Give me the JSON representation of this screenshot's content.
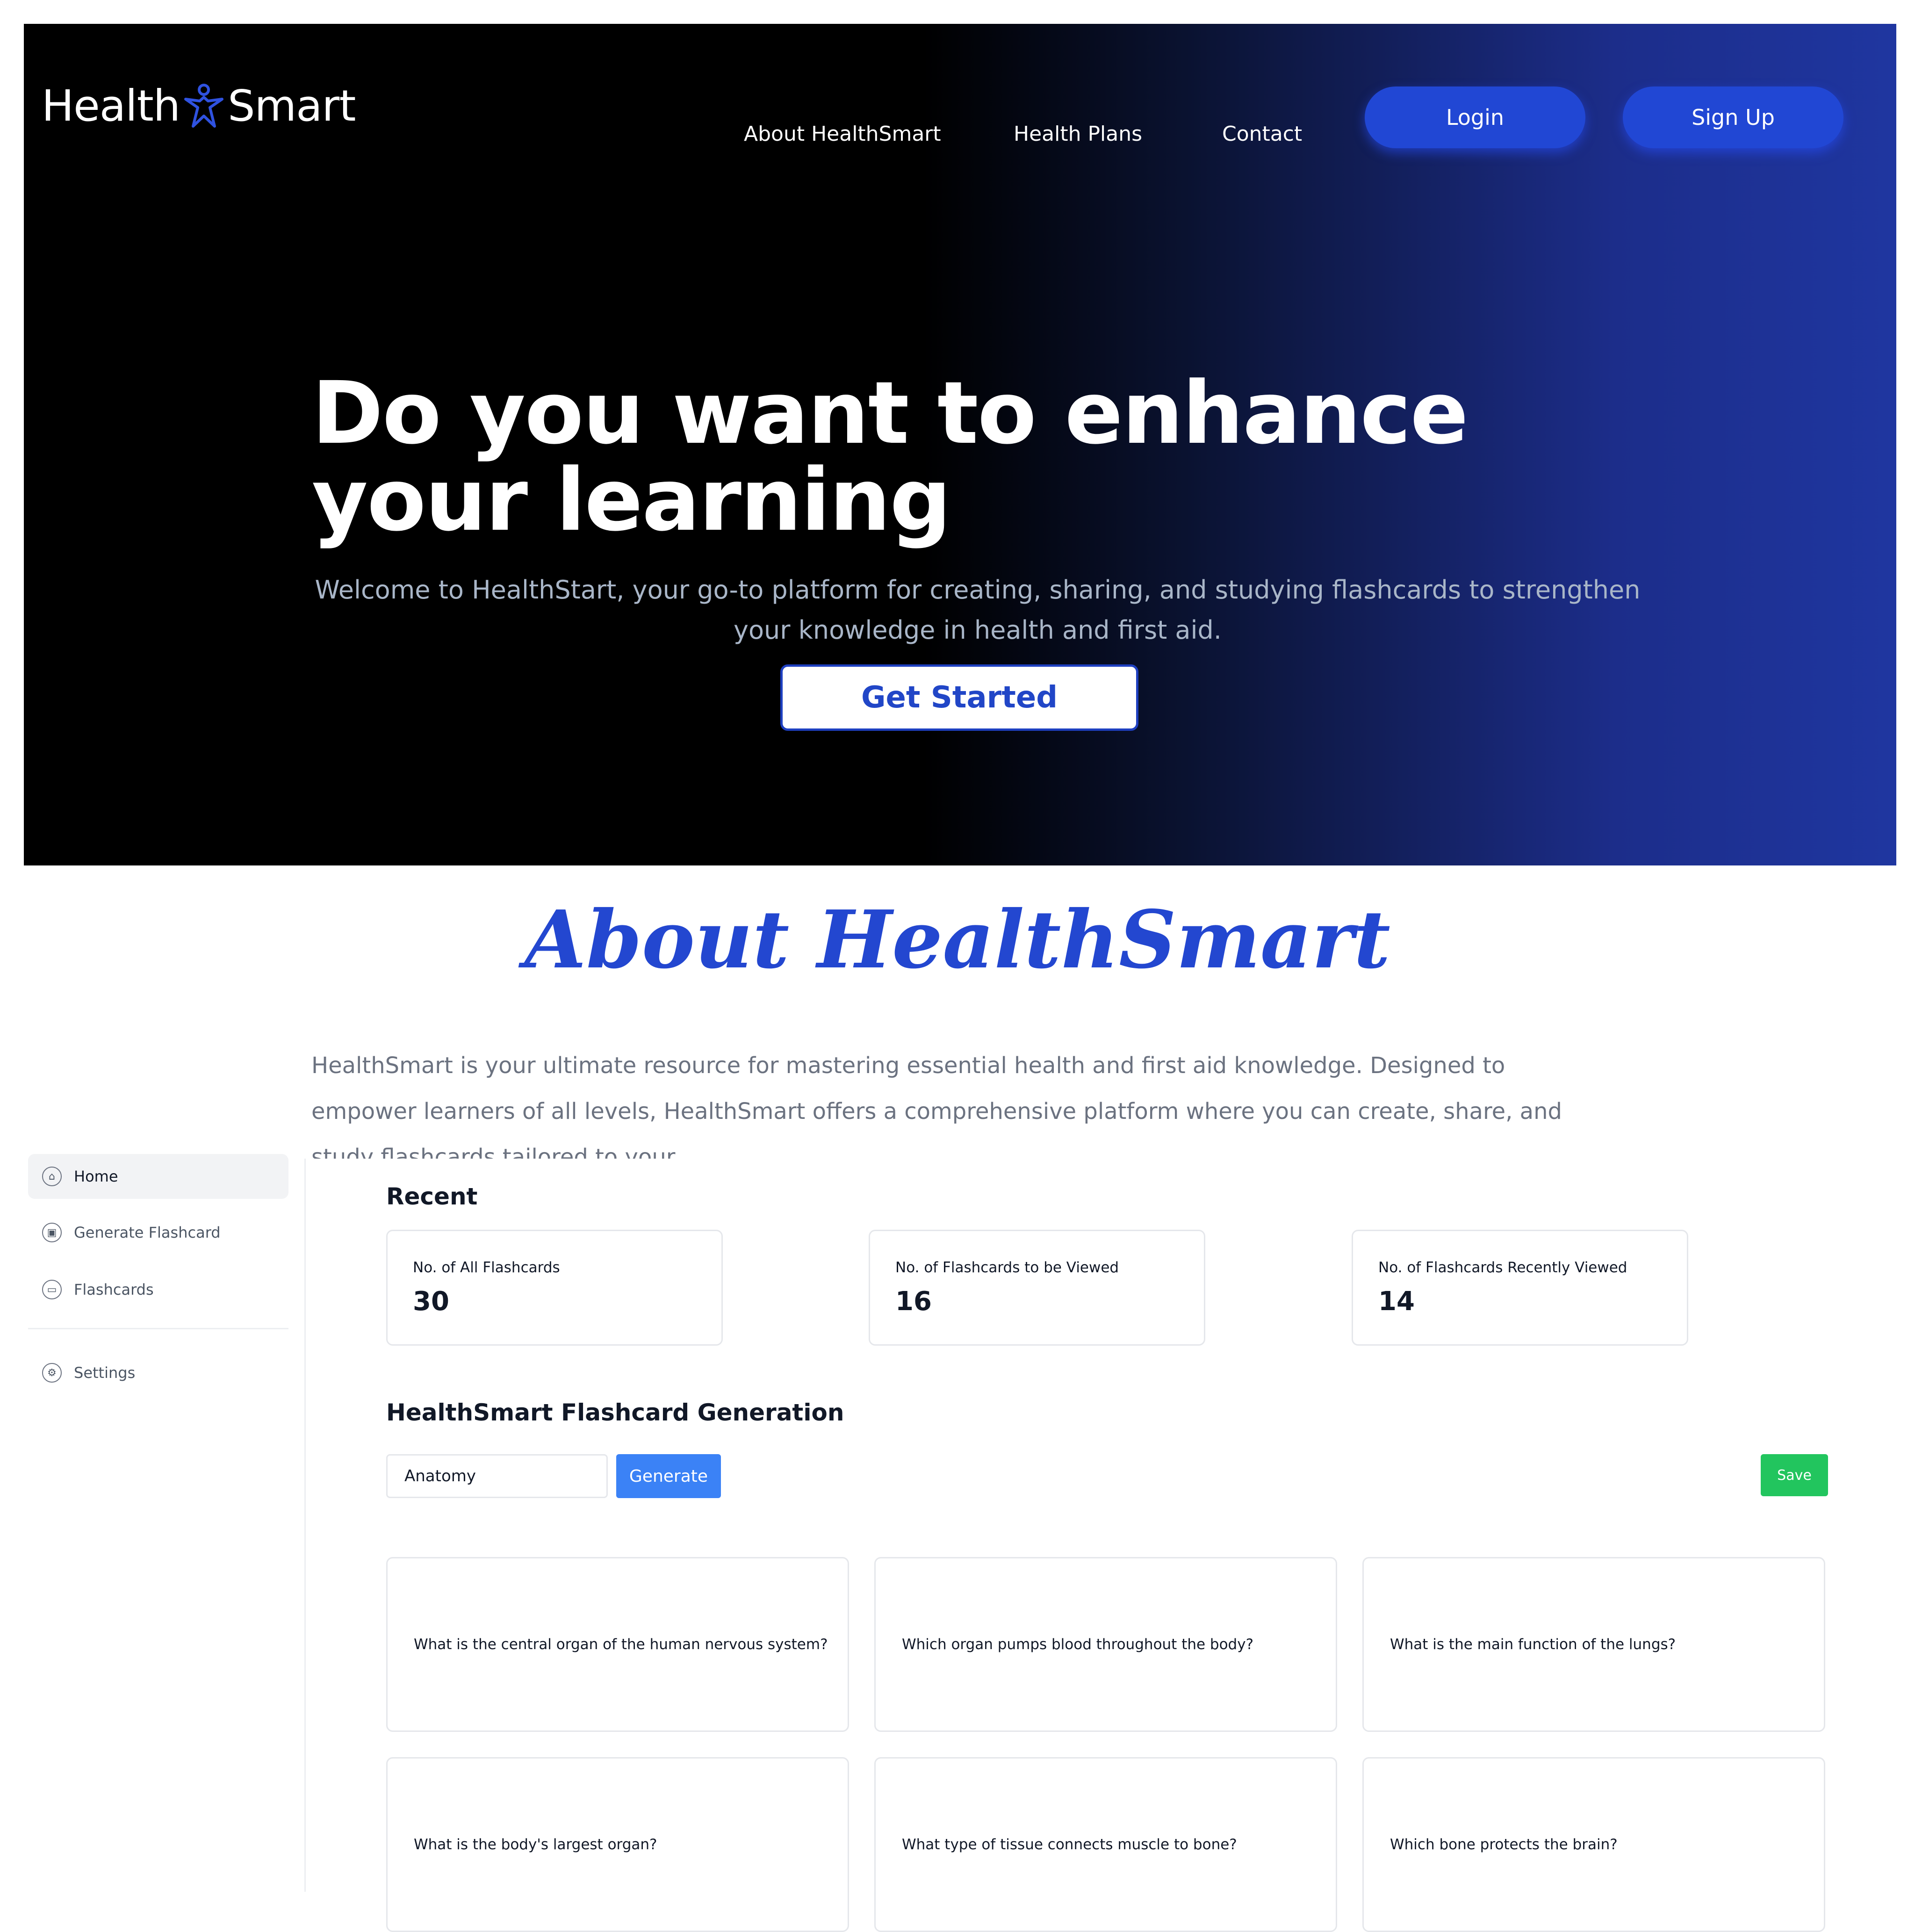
{
  "colors": {
    "hero_dark": "#000000",
    "hero_blue": "#1f36a0",
    "accent_blue": "#2147d4",
    "generate_blue": "#3b82f6",
    "save_green": "#22c55e"
  },
  "header": {
    "logo_left": "Health",
    "logo_icon": "person-star-icon",
    "logo_right": "Smart",
    "nav": [
      "About HealthSmart",
      "Health Plans",
      "Contact"
    ],
    "login_label": "Login",
    "signup_label": "Sign Up"
  },
  "hero": {
    "title": "Do you want to enhance your learning",
    "subtitle": "Welcome to HealthStart, your go-to platform for creating, sharing, and studying flashcards to strengthen your knowledge in health and first aid.",
    "cta_label": "Get Started"
  },
  "about": {
    "title": "About HealthSmart",
    "text": "HealthSmart is your ultimate resource for mastering essential health and first aid knowledge. Designed to empower learners of all levels, HealthSmart offers a comprehensive platform where you can create, share, and study flashcards tailored to your"
  },
  "sidebar": {
    "items": [
      {
        "label": "Home",
        "icon": "home-icon"
      },
      {
        "label": "Generate Flashcard",
        "icon": "robot-icon"
      },
      {
        "label": "Flashcards",
        "icon": "folder-icon"
      }
    ],
    "settings": {
      "label": "Settings",
      "icon": "gear-icon"
    }
  },
  "recent": {
    "title": "Recent",
    "stats": [
      {
        "label": "No. of All Flashcards",
        "value": "30"
      },
      {
        "label": "No. of Flashcards to be Viewed",
        "value": "16"
      },
      {
        "label": "No. of Flashcards Recently Viewed",
        "value": "14"
      }
    ]
  },
  "generation": {
    "title": "HealthSmart Flashcard Generation",
    "input_value": "Anatomy",
    "generate_label": "Generate",
    "save_label": "Save",
    "cards": [
      "What is the central organ of the human nervous system?",
      "Which organ pumps blood throughout the body?",
      "What is the main function of the lungs?",
      "What is the body's largest organ?",
      "What type of tissue connects muscle to bone?",
      "Which bone protects the brain?"
    ]
  }
}
